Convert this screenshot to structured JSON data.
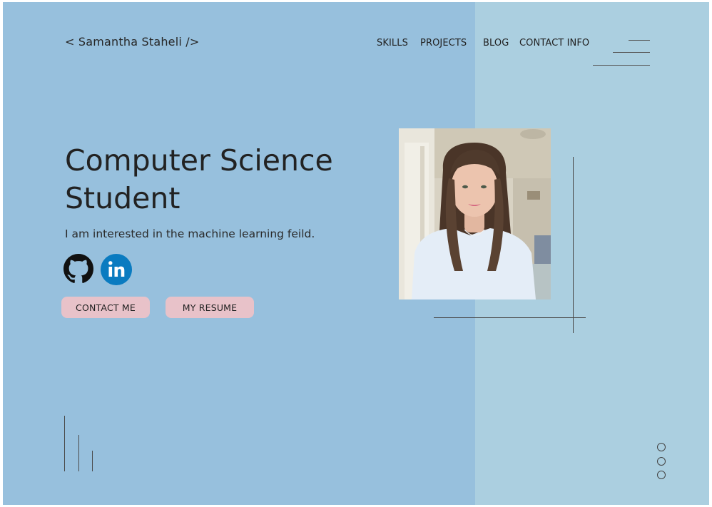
{
  "header": {
    "logo_text": "< Samantha Staheli />",
    "nav": [
      {
        "label": "SKILLS"
      },
      {
        "label": "PROJECTS"
      },
      {
        "label": "BLOG"
      },
      {
        "label": "CONTACT INFO"
      }
    ],
    "menu_icon": "menu-lines-icon"
  },
  "hero": {
    "title_line1": "Computer Science",
    "title_line2": "Student",
    "subtitle": "I am interested in the machine learning feild.",
    "social": [
      {
        "icon": "github-icon"
      },
      {
        "icon": "linkedin-icon",
        "text": "in"
      }
    ],
    "buttons": {
      "contact_label": "CONTACT ME",
      "resume_label": "MY RESUME"
    }
  },
  "colors": {
    "left_bg": "#97c0dd",
    "right_bg": "#abcfe0",
    "button_bg": "#e8c2c9",
    "linkedin_blue": "#0a7bc0"
  },
  "pagination": {
    "dots": 3
  }
}
